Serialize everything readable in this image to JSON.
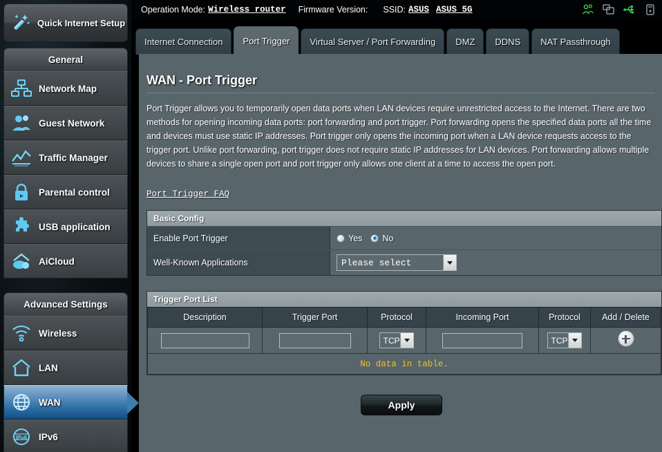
{
  "topbar": {
    "operation_mode_label": "Operation Mode:",
    "operation_mode_value": "Wireless router",
    "firmware_label": "Firmware Version:",
    "firmware_value": "",
    "ssid_label": "SSID:",
    "ssid_value_1": "ASUS",
    "ssid_value_2": "ASUS_5G",
    "icons": [
      {
        "name": "guest-network-icon",
        "color": "#2fd34a"
      },
      {
        "name": "client-list-icon",
        "color": "#8d9699"
      },
      {
        "name": "usb-icon",
        "color": "#2fd34a"
      },
      {
        "name": "printer-icon",
        "color": "#8d9699"
      }
    ]
  },
  "sidebar": {
    "quick_setup": {
      "label": "Quick Internet Setup",
      "icon": "magic-wand-icon"
    },
    "general_header": "General",
    "general_items": [
      {
        "label": "Network Map",
        "icon": "network-map-icon"
      },
      {
        "label": "Guest Network",
        "icon": "guest-network-icon"
      },
      {
        "label": "Traffic Manager",
        "icon": "traffic-manager-icon"
      },
      {
        "label": "Parental control",
        "icon": "lock-icon"
      },
      {
        "label": "USB application",
        "icon": "puzzle-icon"
      },
      {
        "label": "AiCloud",
        "icon": "cloud-home-icon"
      }
    ],
    "advanced_header": "Advanced Settings",
    "advanced_items": [
      {
        "label": "Wireless",
        "icon": "wifi-icon",
        "active": false
      },
      {
        "label": "LAN",
        "icon": "home-icon",
        "active": false
      },
      {
        "label": "WAN",
        "icon": "globe-icon",
        "active": true
      },
      {
        "label": "IPv6",
        "icon": "ipv6-globe-icon",
        "active": false
      }
    ]
  },
  "tabs": [
    {
      "label": "Internet Connection",
      "active": false
    },
    {
      "label": "Port Trigger",
      "active": true
    },
    {
      "label": "Virtual Server / Port Forwarding",
      "active": false
    },
    {
      "label": "DMZ",
      "active": false
    },
    {
      "label": "DDNS",
      "active": false
    },
    {
      "label": "NAT Passthrough",
      "active": false
    }
  ],
  "main": {
    "page_title": "WAN - Port Trigger",
    "description": "Port Trigger allows you to temporarily open data ports when LAN devices require unrestricted access to the Internet. There are two methods for opening incoming data ports: port forwarding and port trigger. Port forwarding opens the specified data ports all the time and devices must use static IP addresses. Port trigger only opens the incoming port when a LAN device requests access to the trigger port. Unlike port forwarding, port trigger does not require static IP addresses for LAN devices. Port forwarding allows multiple devices to share a single open port and port trigger only allows one client at a time to access the open port.",
    "faq_link": "Port Trigger FAQ",
    "basic_config": {
      "header": "Basic Config",
      "enable_label": "Enable Port Trigger",
      "radio_yes": "Yes",
      "radio_no": "No",
      "selected": "No",
      "wka_label": "Well-Known Applications",
      "wka_value": "Please select"
    },
    "trigger_port_list": {
      "header": "Trigger Port List",
      "columns": [
        "Description",
        "Trigger Port",
        "Protocol",
        "Incoming Port",
        "Protocol",
        "Add / Delete"
      ],
      "input_row": {
        "description": "",
        "trigger_port": "",
        "protocol_1": "TCP",
        "incoming_port": "",
        "protocol_2": "TCP",
        "add_icon": "plus-circle-icon"
      },
      "empty_message": "No data in table."
    },
    "apply_label": "Apply"
  },
  "colors": {
    "accent": "#2fd34a",
    "panel_bg": "#58656b",
    "label_bg": "#3e4b52",
    "header_bg": "#8f9a9f",
    "warning_text": "#f4c21b",
    "active_nav": "#2a6ca3"
  }
}
